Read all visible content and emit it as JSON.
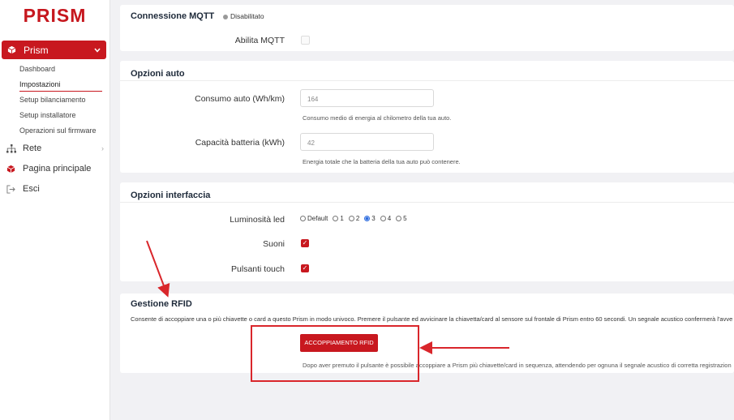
{
  "app": {
    "logo": "PRISM"
  },
  "sidebar": {
    "main": {
      "label": "Prism",
      "icon": "cube-icon"
    },
    "sub_items": [
      {
        "label": "Dashboard"
      },
      {
        "label": "Impostazioni"
      },
      {
        "label": "Setup bilanciamento"
      },
      {
        "label": "Setup installatore"
      },
      {
        "label": "Operazioni sul firmware"
      }
    ],
    "items": [
      {
        "label": "Rete",
        "icon": "network-icon"
      },
      {
        "label": "Pagina principale",
        "icon": "cube-icon"
      },
      {
        "label": "Esci",
        "icon": "logout-icon"
      }
    ]
  },
  "mqtt": {
    "title": "Connessione MQTT",
    "status": "Disabilitato",
    "enable_label": "Abilita MQTT"
  },
  "auto": {
    "title": "Opzioni auto",
    "consumption_label": "Consumo auto (Wh/km)",
    "consumption_value": "164",
    "consumption_help": "Consumo medio di energia al chilometro della tua auto.",
    "battery_label": "Capacità batteria (kWh)",
    "battery_value": "42",
    "battery_help": "Energia totale che la batteria della tua auto può contenere."
  },
  "interface": {
    "title": "Opzioni interfaccia",
    "brightness_label": "Luminosità led",
    "brightness_options": [
      "Default",
      "1",
      "2",
      "3",
      "4",
      "5"
    ],
    "brightness_selected": "3",
    "sounds_label": "Suoni",
    "touch_label": "Pulsanti touch"
  },
  "rfid": {
    "title": "Gestione RFID",
    "description": "Consente di accoppiare una o più chiavette o card a questo Prism in modo univoco. Premere il pulsante ed avvicinare la chiavetta/card al sensore sul frontale di Prism entro 60 secondi. Un segnale acustico confermerà l'avve",
    "button": "ACCOPPIAMENTO RFID",
    "help": "Dopo aver premuto il pulsante è possibile accoppiare a Prism più chiavette/card in sequenza, attendendo per ognuna il segnale acustico di corretta registrazion"
  },
  "colors": {
    "accent": "#c8181f",
    "annotation": "#d9262b",
    "background": "#f1f1f4"
  }
}
